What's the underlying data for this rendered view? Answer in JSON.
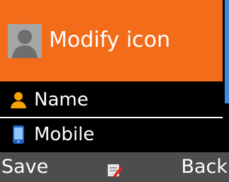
{
  "header": {
    "title": "Modify icon",
    "icon": "avatar-placeholder-icon"
  },
  "list": {
    "items": [
      {
        "label": "Name",
        "icon": "person-icon"
      },
      {
        "label": "Mobile",
        "icon": "mobile-phone-icon"
      }
    ]
  },
  "softkeys": {
    "left": "Save",
    "center_icon": "edit-icon",
    "right": "Back"
  },
  "colors": {
    "header_bg": "#f26c1a",
    "scroll_accent": "#3a8ce0",
    "softbar_bg": "#4d4d4d"
  }
}
